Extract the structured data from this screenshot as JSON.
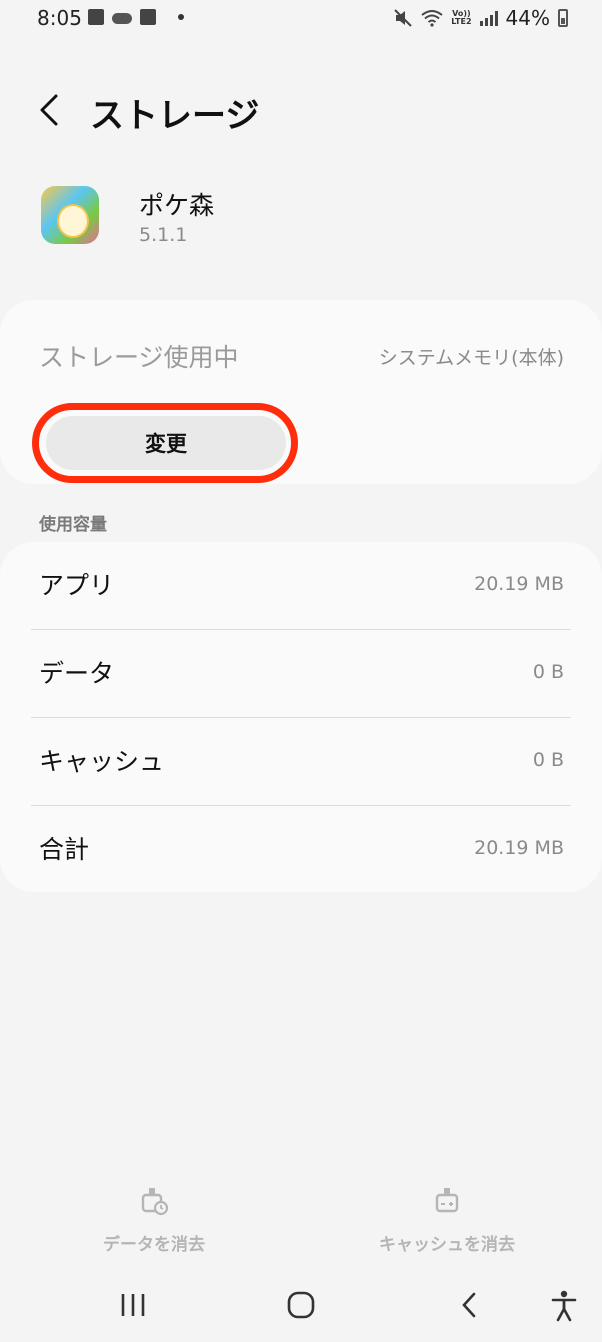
{
  "status_bar": {
    "time": "8:05",
    "battery": "44%",
    "network": "LTE2",
    "volte": "Vo))"
  },
  "header": {
    "title": "ストレージ"
  },
  "app": {
    "name": "ポケ森",
    "version": "5.1.1"
  },
  "storage": {
    "label": "ストレージ使用中",
    "value": "システムメモリ(本体)",
    "change_button": "変更"
  },
  "usage": {
    "section_title": "使用容量",
    "rows": [
      {
        "label": "アプリ",
        "value": "20.19 MB"
      },
      {
        "label": "データ",
        "value": "0 B"
      },
      {
        "label": "キャッシュ",
        "value": "0 B"
      },
      {
        "label": "合計",
        "value": "20.19 MB"
      }
    ]
  },
  "actions": {
    "clear_data": "データを消去",
    "clear_cache": "キャッシュを消去"
  },
  "colors": {
    "highlight_ring": "#ff2d0c",
    "background": "#f4f4f4",
    "card": "#fafafa"
  }
}
